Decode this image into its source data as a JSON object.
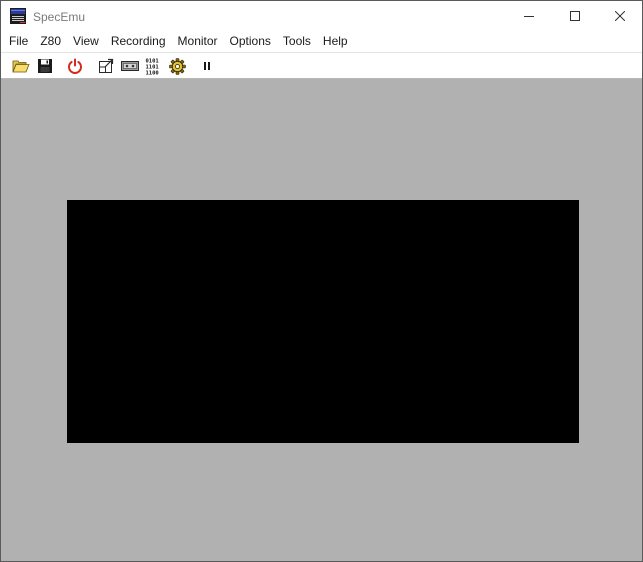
{
  "window": {
    "title": "SpecEmu"
  },
  "menu": {
    "items": [
      {
        "label": "File"
      },
      {
        "label": "Z80"
      },
      {
        "label": "View"
      },
      {
        "label": "Recording"
      },
      {
        "label": "Monitor"
      },
      {
        "label": "Options"
      },
      {
        "label": "Tools"
      },
      {
        "label": "Help"
      }
    ]
  },
  "toolbar": {
    "buttons": [
      {
        "icon": "open-folder-icon"
      },
      {
        "icon": "save-disk-icon"
      },
      {
        "icon": "power-icon"
      },
      {
        "icon": "window-resize-icon"
      },
      {
        "icon": "tape-cassette-icon"
      },
      {
        "icon": "binary-memory-icon"
      },
      {
        "icon": "settings-gear-icon"
      },
      {
        "icon": "pause-icon"
      }
    ],
    "binary_text": [
      "0101",
      "1101",
      "1100"
    ]
  },
  "colors": {
    "emulator_background": "#b1b1b1",
    "screen": "#000000",
    "power_icon": "#d42a1f",
    "title_text": "#7a7a7a"
  }
}
